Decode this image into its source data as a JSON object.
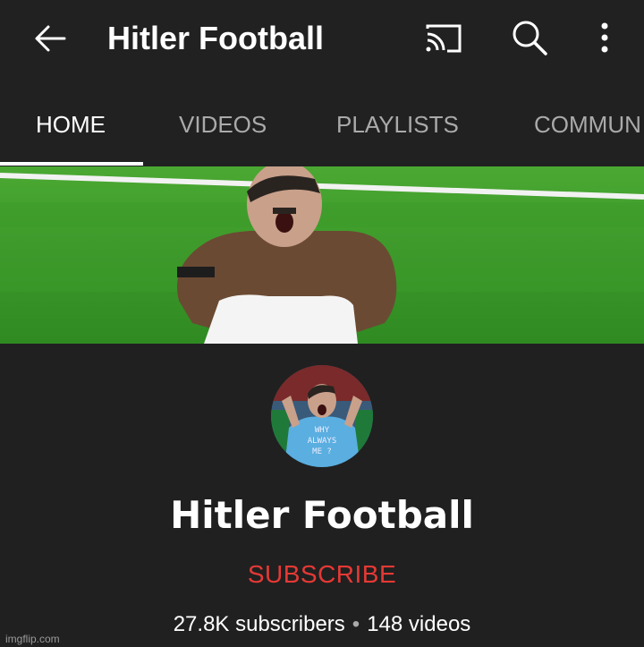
{
  "header": {
    "title": "Hitler Football",
    "icons": [
      "back-arrow-icon",
      "cast-icon",
      "search-icon",
      "more-vert-icon"
    ]
  },
  "tabs": [
    {
      "label": "HOME",
      "active": true
    },
    {
      "label": "VIDEOS",
      "active": false
    },
    {
      "label": "PLAYLISTS",
      "active": false
    },
    {
      "label": "COMMUN",
      "active": false
    }
  ],
  "channel": {
    "name": "Hitler Football",
    "subscribe_label": "SUBSCRIBE",
    "subscribers": "27.8K subscribers",
    "separator": "•",
    "videos": "148 videos",
    "avatar_shirt_text": [
      "WHY",
      "ALWAYS",
      "ME ?"
    ]
  },
  "watermark": "imgflip.com",
  "colors": {
    "background": "#202020",
    "accent_subscribe": "#e53935",
    "tab_inactive": "#aaaaaa",
    "banner_grass": "#3f9a2a"
  }
}
